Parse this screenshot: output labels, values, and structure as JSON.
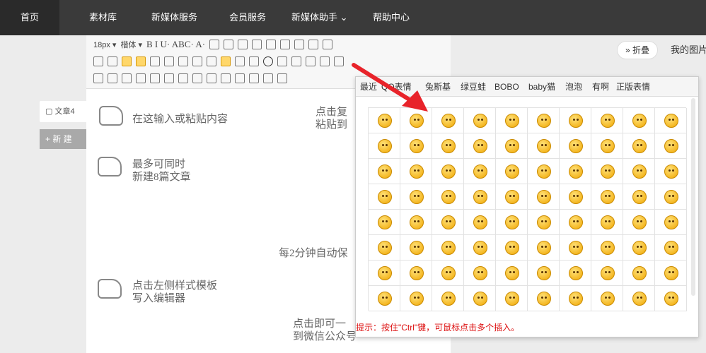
{
  "nav": {
    "home": "首页",
    "items": [
      "素材库",
      "新媒体服务",
      "会员服务",
      "新媒体助手 ⌄",
      "帮助中心"
    ]
  },
  "toolbar": {
    "font_size": "18px",
    "font_family": "楷体",
    "row1_glyphs": "B   I   U·  ABC·  A·"
  },
  "sidebar": {
    "doc_tab": "文章4",
    "new_button": "+ 新 建"
  },
  "editor_hints": [
    "在这输入或粘贴内容",
    "最多可同时",
    "新建8篇文章",
    "点击左侧样式模板",
    "写入编辑器",
    "点击复",
    "粘贴到",
    "每2分钟自动保",
    "点击即可一",
    "到微信公众号"
  ],
  "right_panel": {
    "fold_button": "» 折叠",
    "my_images": "我的图片"
  },
  "emoji_popup": {
    "tabs": [
      "最近",
      "QQ表情",
      "兔斯基",
      "绿豆蛙",
      "BOBO",
      "baby猫",
      "泡泡",
      "有啊",
      "正版表情"
    ],
    "tip": "提示：按住\"Ctrl\"键，可鼠标点击多个插入。",
    "rows": 8,
    "cols": 10
  },
  "colors": {
    "nav_bg": "#3a3a3a",
    "tip_red": "#dd1111",
    "arrow_red": "#e8232a"
  }
}
